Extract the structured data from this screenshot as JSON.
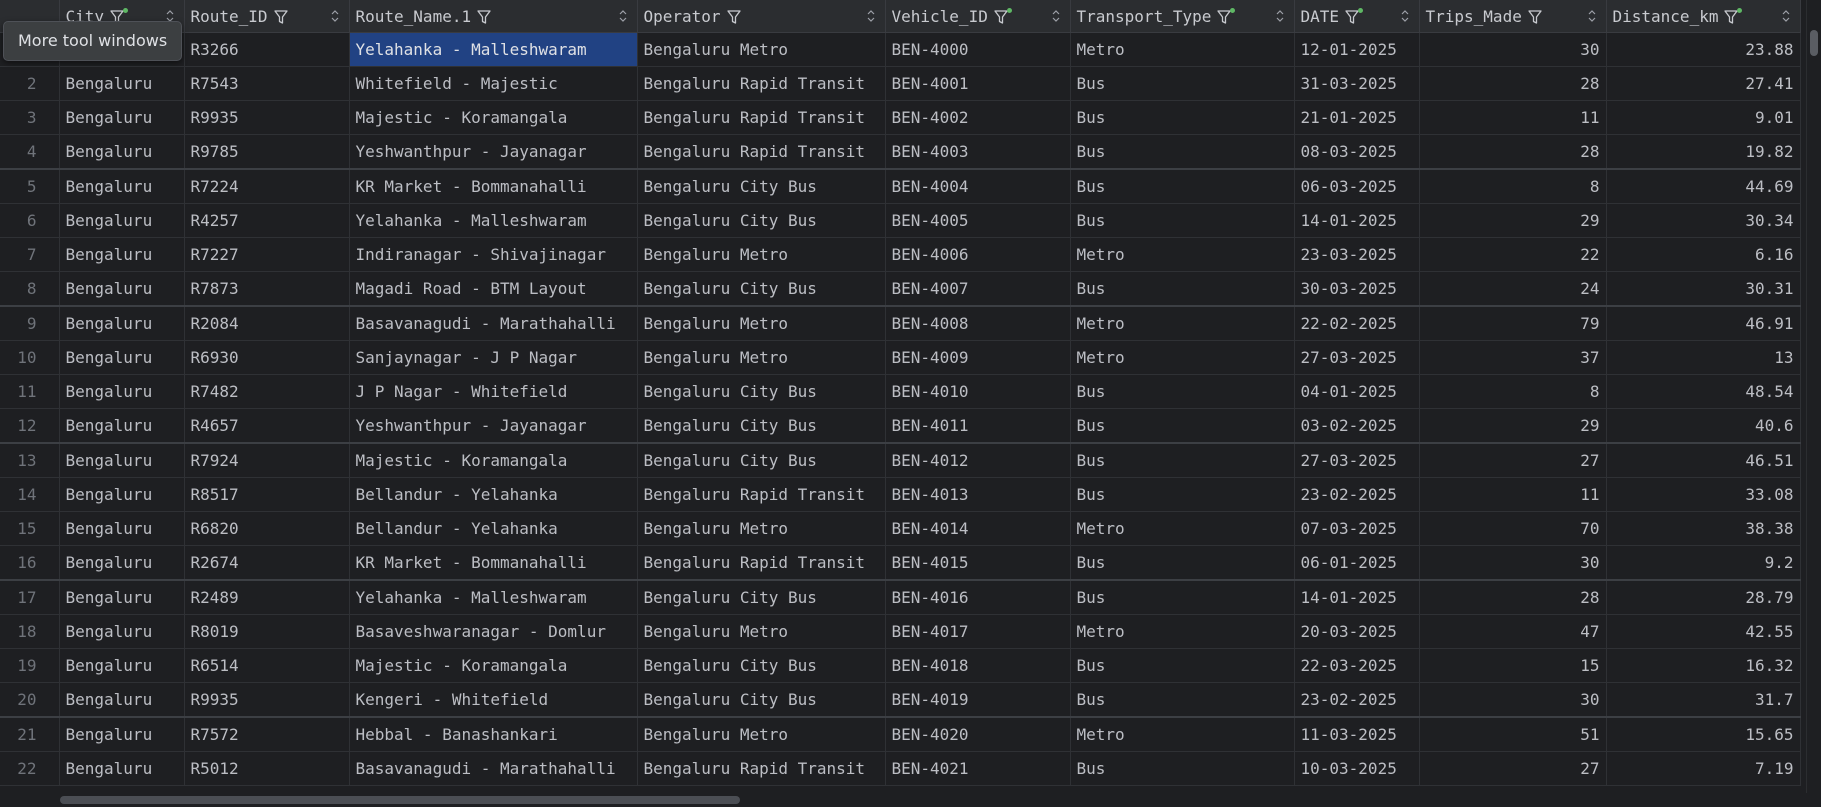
{
  "tooltip": "More tool windows",
  "columns": [
    {
      "key": "city",
      "label": "City",
      "filtered": true
    },
    {
      "key": "route_id",
      "label": "Route_ID",
      "filtered": false
    },
    {
      "key": "route_name",
      "label": "Route_Name.1",
      "filtered": false
    },
    {
      "key": "operator",
      "label": "Operator",
      "filtered": false
    },
    {
      "key": "vehicle_id",
      "label": "Vehicle_ID",
      "filtered": true
    },
    {
      "key": "transport_type",
      "label": "Transport_Type",
      "filtered": true
    },
    {
      "key": "date",
      "label": "DATE",
      "filtered": true
    },
    {
      "key": "trips_made",
      "label": "Trips_Made",
      "filtered": false
    },
    {
      "key": "distance_km",
      "label": "Distance_km",
      "filtered": true
    }
  ],
  "rows": [
    {
      "n": "",
      "city": "",
      "route_id": "R3266",
      "route_name": "Yelahanka - Malleshwaram",
      "operator": "Bengaluru Metro",
      "vehicle_id": "BEN-4000",
      "transport_type": "Metro",
      "date": "12-01-2025",
      "trips_made": "30",
      "distance_km": "23.88"
    },
    {
      "n": "2",
      "city": "Bengaluru",
      "route_id": "R7543",
      "route_name": "Whitefield - Majestic",
      "operator": "Bengaluru Rapid Transit",
      "vehicle_id": "BEN-4001",
      "transport_type": "Bus",
      "date": "31-03-2025",
      "trips_made": "28",
      "distance_km": "27.41"
    },
    {
      "n": "3",
      "city": "Bengaluru",
      "route_id": "R9935",
      "route_name": "Majestic - Koramangala",
      "operator": "Bengaluru Rapid Transit",
      "vehicle_id": "BEN-4002",
      "transport_type": "Bus",
      "date": "21-01-2025",
      "trips_made": "11",
      "distance_km": "9.01"
    },
    {
      "n": "4",
      "city": "Bengaluru",
      "route_id": "R9785",
      "route_name": "Yeshwanthpur - Jayanagar",
      "operator": "Bengaluru Rapid Transit",
      "vehicle_id": "BEN-4003",
      "transport_type": "Bus",
      "date": "08-03-2025",
      "trips_made": "28",
      "distance_km": "19.82"
    },
    {
      "n": "5",
      "city": "Bengaluru",
      "route_id": "R7224",
      "route_name": "KR Market - Bommanahalli",
      "operator": "Bengaluru City Bus",
      "vehicle_id": "BEN-4004",
      "transport_type": "Bus",
      "date": "06-03-2025",
      "trips_made": "8",
      "distance_km": "44.69"
    },
    {
      "n": "6",
      "city": "Bengaluru",
      "route_id": "R4257",
      "route_name": "Yelahanka - Malleshwaram",
      "operator": "Bengaluru City Bus",
      "vehicle_id": "BEN-4005",
      "transport_type": "Bus",
      "date": "14-01-2025",
      "trips_made": "29",
      "distance_km": "30.34"
    },
    {
      "n": "7",
      "city": "Bengaluru",
      "route_id": "R7227",
      "route_name": "Indiranagar - Shivajinagar",
      "operator": "Bengaluru Metro",
      "vehicle_id": "BEN-4006",
      "transport_type": "Metro",
      "date": "23-03-2025",
      "trips_made": "22",
      "distance_km": "6.16"
    },
    {
      "n": "8",
      "city": "Bengaluru",
      "route_id": "R7873",
      "route_name": "Magadi Road - BTM Layout",
      "operator": "Bengaluru City Bus",
      "vehicle_id": "BEN-4007",
      "transport_type": "Bus",
      "date": "30-03-2025",
      "trips_made": "24",
      "distance_km": "30.31"
    },
    {
      "n": "9",
      "city": "Bengaluru",
      "route_id": "R2084",
      "route_name": "Basavanagudi - Marathahalli",
      "operator": "Bengaluru Metro",
      "vehicle_id": "BEN-4008",
      "transport_type": "Metro",
      "date": "22-02-2025",
      "trips_made": "79",
      "distance_km": "46.91"
    },
    {
      "n": "10",
      "city": "Bengaluru",
      "route_id": "R6930",
      "route_name": "Sanjaynagar - J P Nagar",
      "operator": "Bengaluru Metro",
      "vehicle_id": "BEN-4009",
      "transport_type": "Metro",
      "date": "27-03-2025",
      "trips_made": "37",
      "distance_km": "13"
    },
    {
      "n": "11",
      "city": "Bengaluru",
      "route_id": "R7482",
      "route_name": "J P Nagar - Whitefield",
      "operator": "Bengaluru City Bus",
      "vehicle_id": "BEN-4010",
      "transport_type": "Bus",
      "date": "04-01-2025",
      "trips_made": "8",
      "distance_km": "48.54"
    },
    {
      "n": "12",
      "city": "Bengaluru",
      "route_id": "R4657",
      "route_name": "Yeshwanthpur - Jayanagar",
      "operator": "Bengaluru City Bus",
      "vehicle_id": "BEN-4011",
      "transport_type": "Bus",
      "date": "03-02-2025",
      "trips_made": "29",
      "distance_km": "40.6"
    },
    {
      "n": "13",
      "city": "Bengaluru",
      "route_id": "R7924",
      "route_name": "Majestic - Koramangala",
      "operator": "Bengaluru City Bus",
      "vehicle_id": "BEN-4012",
      "transport_type": "Bus",
      "date": "27-03-2025",
      "trips_made": "27",
      "distance_km": "46.51"
    },
    {
      "n": "14",
      "city": "Bengaluru",
      "route_id": "R8517",
      "route_name": "Bellandur - Yelahanka",
      "operator": "Bengaluru Rapid Transit",
      "vehicle_id": "BEN-4013",
      "transport_type": "Bus",
      "date": "23-02-2025",
      "trips_made": "11",
      "distance_km": "33.08"
    },
    {
      "n": "15",
      "city": "Bengaluru",
      "route_id": "R6820",
      "route_name": "Bellandur - Yelahanka",
      "operator": "Bengaluru Metro",
      "vehicle_id": "BEN-4014",
      "transport_type": "Metro",
      "date": "07-03-2025",
      "trips_made": "70",
      "distance_km": "38.38"
    },
    {
      "n": "16",
      "city": "Bengaluru",
      "route_id": "R2674",
      "route_name": "KR Market - Bommanahalli",
      "operator": "Bengaluru Rapid Transit",
      "vehicle_id": "BEN-4015",
      "transport_type": "Bus",
      "date": "06-01-2025",
      "trips_made": "30",
      "distance_km": "9.2"
    },
    {
      "n": "17",
      "city": "Bengaluru",
      "route_id": "R2489",
      "route_name": "Yelahanka - Malleshwaram",
      "operator": "Bengaluru City Bus",
      "vehicle_id": "BEN-4016",
      "transport_type": "Bus",
      "date": "14-01-2025",
      "trips_made": "28",
      "distance_km": "28.79"
    },
    {
      "n": "18",
      "city": "Bengaluru",
      "route_id": "R8019",
      "route_name": "Basaveshwaranagar - Domlur",
      "operator": "Bengaluru Metro",
      "vehicle_id": "BEN-4017",
      "transport_type": "Metro",
      "date": "20-03-2025",
      "trips_made": "47",
      "distance_km": "42.55"
    },
    {
      "n": "19",
      "city": "Bengaluru",
      "route_id": "R6514",
      "route_name": "Majestic - Koramangala",
      "operator": "Bengaluru City Bus",
      "vehicle_id": "BEN-4018",
      "transport_type": "Bus",
      "date": "22-03-2025",
      "trips_made": "15",
      "distance_km": "16.32"
    },
    {
      "n": "20",
      "city": "Bengaluru",
      "route_id": "R9935",
      "route_name": "Kengeri - Whitefield",
      "operator": "Bengaluru City Bus",
      "vehicle_id": "BEN-4019",
      "transport_type": "Bus",
      "date": "23-02-2025",
      "trips_made": "30",
      "distance_km": "31.7"
    },
    {
      "n": "21",
      "city": "Bengaluru",
      "route_id": "R7572",
      "route_name": "Hebbal - Banashankari",
      "operator": "Bengaluru Metro",
      "vehicle_id": "BEN-4020",
      "transport_type": "Metro",
      "date": "11-03-2025",
      "trips_made": "51",
      "distance_km": "15.65"
    },
    {
      "n": "22",
      "city": "Bengaluru",
      "route_id": "R5012",
      "route_name": "Basavanagudi - Marathahalli",
      "operator": "Bengaluru Rapid Transit",
      "vehicle_id": "BEN-4021",
      "transport_type": "Bus",
      "date": "10-03-2025",
      "trips_made": "27",
      "distance_km": "7.19"
    }
  ]
}
